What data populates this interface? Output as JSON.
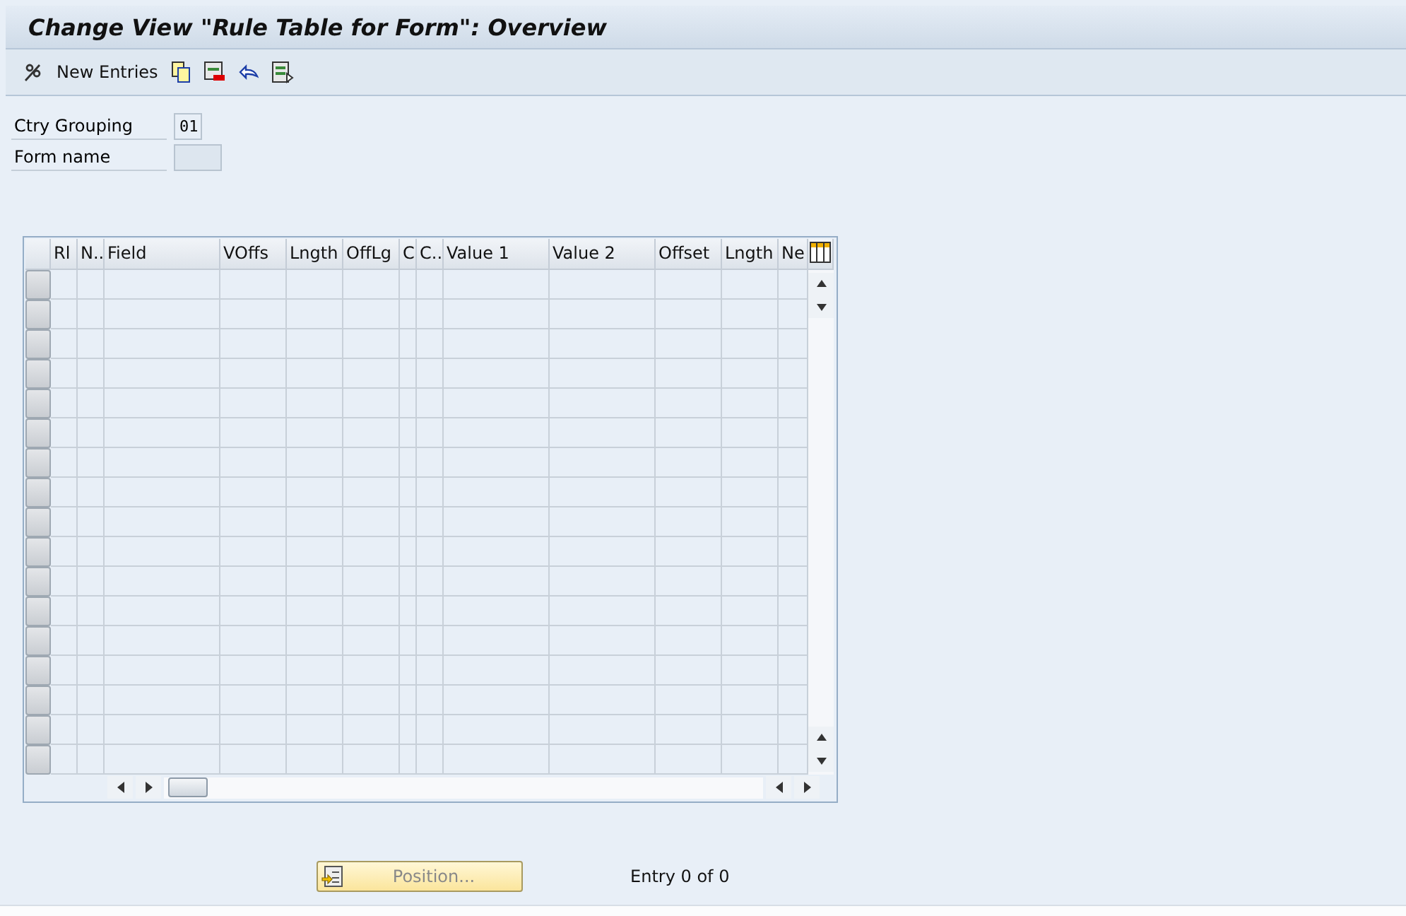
{
  "window": {
    "title": "Change View \"Rule Table for Form\": Overview"
  },
  "toolbar": {
    "new_entries": "New Entries"
  },
  "fields": [
    {
      "label": "Ctry Grouping",
      "value": "01"
    },
    {
      "label": "Form name"
    }
  ],
  "table": {
    "columns": [
      "Rl",
      "N..",
      "Field",
      "VOffs",
      "Lngth",
      "OffLg",
      "C",
      "C..",
      "Value 1",
      "Value 2",
      "Offset",
      "Lngth",
      "Ne"
    ],
    "rows": [
      {
        "selected": false
      },
      {
        "selected": false
      },
      {
        "selected": false
      },
      {
        "selected": false
      },
      {
        "selected": false
      },
      {
        "selected": false
      },
      {
        "selected": false
      },
      {
        "selected": false
      },
      {
        "selected": false
      },
      {
        "selected": false
      },
      {
        "selected": false
      },
      {
        "selected": false
      },
      {
        "selected": false
      },
      {
        "selected": false
      },
      {
        "selected": false
      },
      {
        "selected": false
      },
      {
        "selected": false
      }
    ]
  },
  "position_button": "Position...",
  "entry_info": "Entry 0 of 0"
}
